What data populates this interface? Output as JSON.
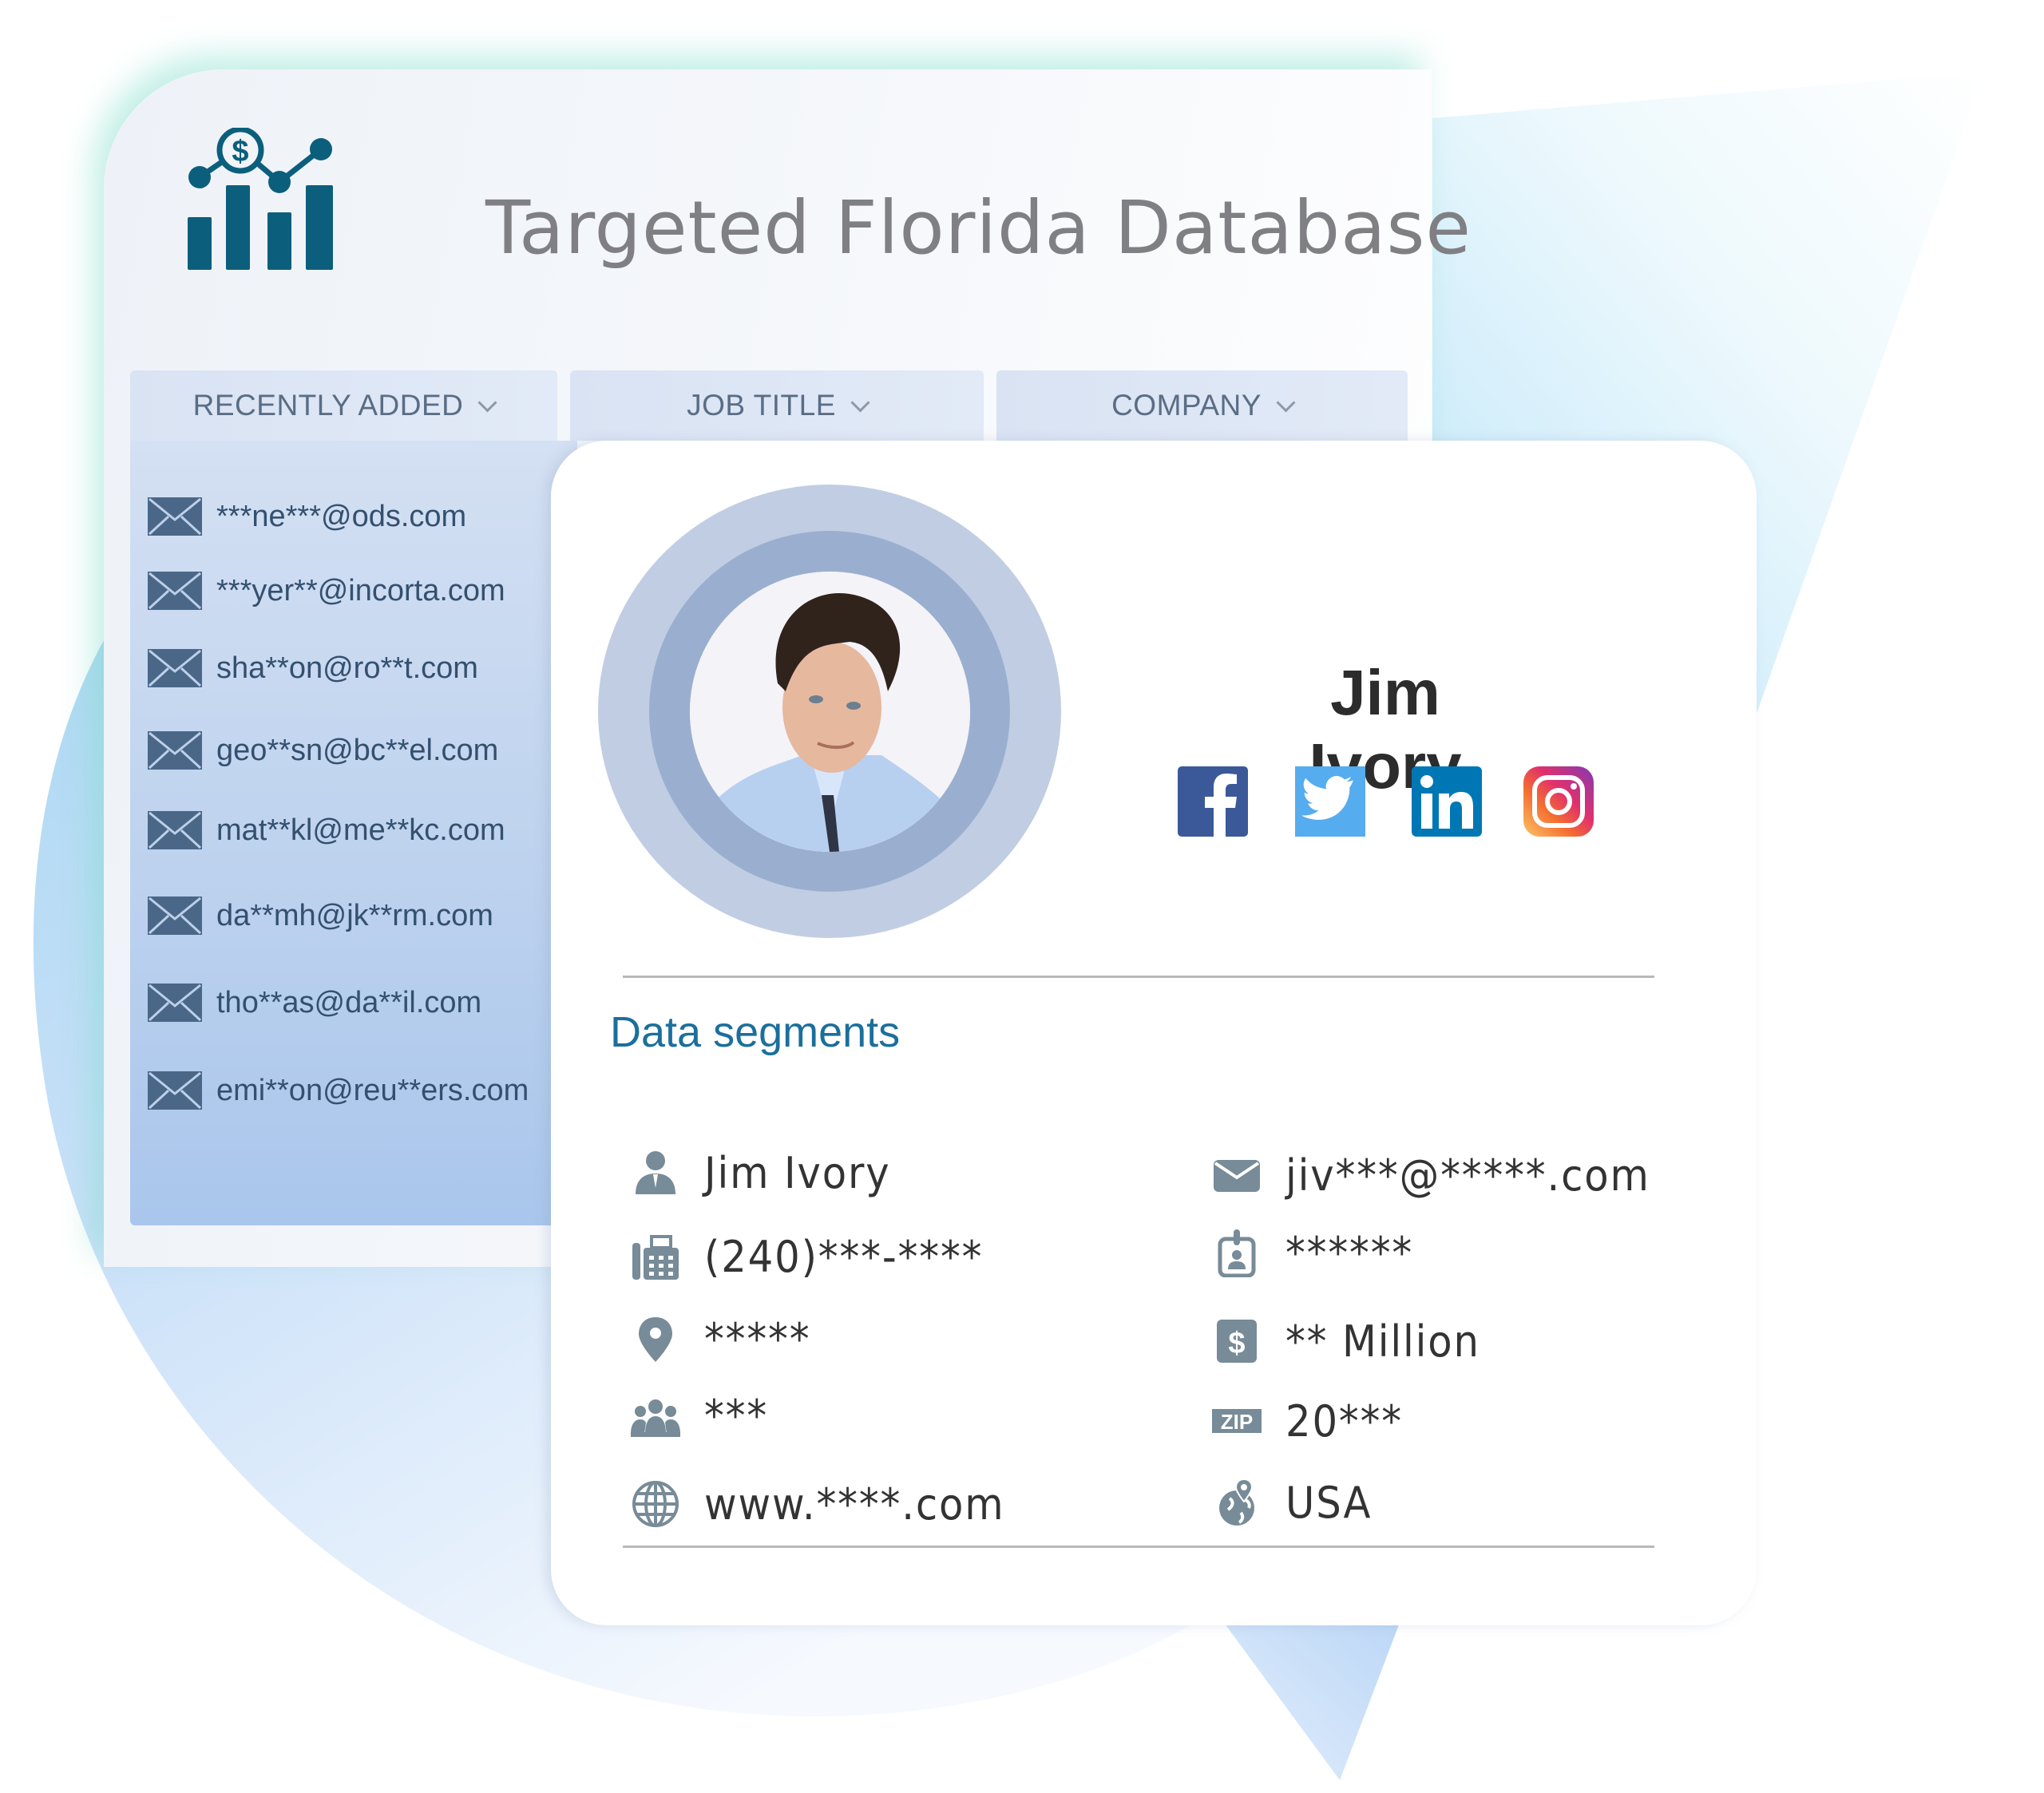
{
  "header": {
    "logo_icon": "chart-dollar-icon",
    "title": "Targeted Florida Database"
  },
  "tabs": [
    {
      "label": "RECENTLY ADDED",
      "icon": "chevron-down-icon"
    },
    {
      "label": "JOB TITLE",
      "icon": "chevron-down-icon"
    },
    {
      "label": "COMPANY",
      "icon": "chevron-down-icon"
    }
  ],
  "recent_emails": [
    "***ne***@ods.com",
    "***yer**@incorta.com",
    "sha**on@ro**t.com",
    "geo**sn@bc**el.com",
    "mat**kl@me**kc.com",
    "da**mh@jk**rm.com",
    "tho**as@da**il.com",
    "emi**on@reu**ers.com"
  ],
  "profile": {
    "name": "Jim Ivory",
    "social": [
      {
        "name": "facebook",
        "color": "#3b5998"
      },
      {
        "name": "twitter",
        "color": "#55acee"
      },
      {
        "name": "linkedin",
        "color": "#0077b5"
      },
      {
        "name": "instagram",
        "color": "#c13584"
      }
    ]
  },
  "segments": {
    "title": "Data segments",
    "left": [
      {
        "icon": "person-icon",
        "value": "Jim Ivory"
      },
      {
        "icon": "phone-fax-icon",
        "value": "(240)***-****"
      },
      {
        "icon": "location-pin-icon",
        "value": "*****"
      },
      {
        "icon": "employees-icon",
        "value": "***"
      },
      {
        "icon": "globe-icon",
        "value": "www.****.com"
      }
    ],
    "right": [
      {
        "icon": "envelope-icon",
        "value": "jiv***@*****.com"
      },
      {
        "icon": "id-badge-icon",
        "value": "******"
      },
      {
        "icon": "dollar-icon",
        "value": "** Million"
      },
      {
        "icon": "zip-icon",
        "value": "20***"
      },
      {
        "icon": "globe-pin-icon",
        "value": "USA"
      }
    ]
  },
  "colors": {
    "accent": "#1b6f9c",
    "logo": "#0b5f7c",
    "icon_gray": "#778b98",
    "email_text": "#34506f"
  }
}
